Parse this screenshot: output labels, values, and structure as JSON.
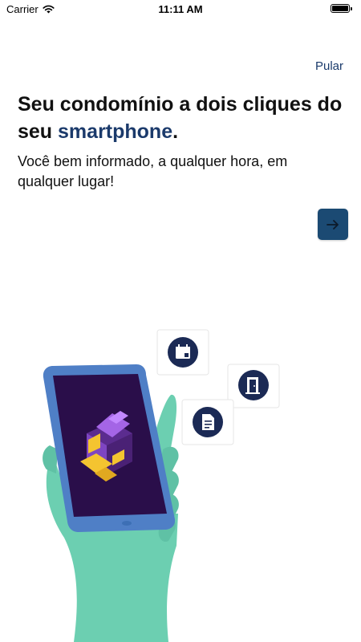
{
  "status_bar": {
    "carrier": "Carrier",
    "time": "11:11 AM"
  },
  "onboarding": {
    "skip_label": "Pular",
    "headline_part1": "Seu condomínio a dois cliques do seu ",
    "headline_accent": "smartphone",
    "headline_end": ".",
    "subtitle": "Você bem informado, a qualquer hora, em qualquer lugar!",
    "next_icon": "arrow-right-icon"
  },
  "colors": {
    "accent": "#1b3a6b",
    "next_button": "#1b4a73",
    "hand": "#6ccfb1",
    "phone_screen": "#2a0e4a",
    "phone_frame": "#4f7fc6"
  },
  "illustration": {
    "badge_icons": [
      "calendar-icon",
      "door-icon",
      "document-icon"
    ]
  }
}
